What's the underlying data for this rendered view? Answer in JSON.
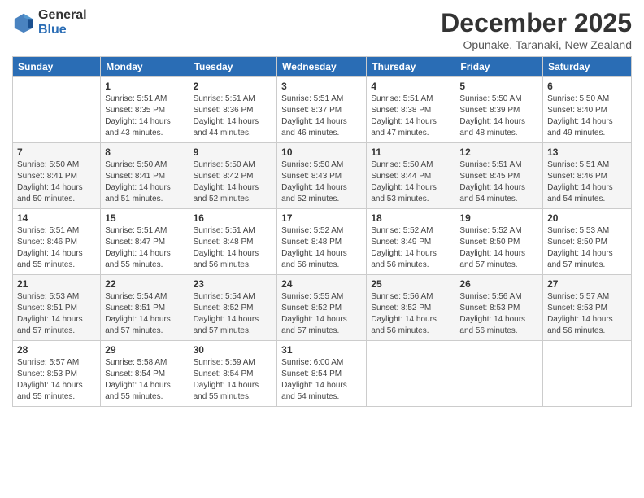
{
  "header": {
    "logo_general": "General",
    "logo_blue": "Blue",
    "month_title": "December 2025",
    "location": "Opunake, Taranaki, New Zealand"
  },
  "days_of_week": [
    "Sunday",
    "Monday",
    "Tuesday",
    "Wednesday",
    "Thursday",
    "Friday",
    "Saturday"
  ],
  "weeks": [
    [
      {
        "day": "",
        "sunrise": "",
        "sunset": "",
        "daylight": ""
      },
      {
        "day": "1",
        "sunrise": "Sunrise: 5:51 AM",
        "sunset": "Sunset: 8:35 PM",
        "daylight": "Daylight: 14 hours and 43 minutes."
      },
      {
        "day": "2",
        "sunrise": "Sunrise: 5:51 AM",
        "sunset": "Sunset: 8:36 PM",
        "daylight": "Daylight: 14 hours and 44 minutes."
      },
      {
        "day": "3",
        "sunrise": "Sunrise: 5:51 AM",
        "sunset": "Sunset: 8:37 PM",
        "daylight": "Daylight: 14 hours and 46 minutes."
      },
      {
        "day": "4",
        "sunrise": "Sunrise: 5:51 AM",
        "sunset": "Sunset: 8:38 PM",
        "daylight": "Daylight: 14 hours and 47 minutes."
      },
      {
        "day": "5",
        "sunrise": "Sunrise: 5:50 AM",
        "sunset": "Sunset: 8:39 PM",
        "daylight": "Daylight: 14 hours and 48 minutes."
      },
      {
        "day": "6",
        "sunrise": "Sunrise: 5:50 AM",
        "sunset": "Sunset: 8:40 PM",
        "daylight": "Daylight: 14 hours and 49 minutes."
      }
    ],
    [
      {
        "day": "7",
        "sunrise": "Sunrise: 5:50 AM",
        "sunset": "Sunset: 8:41 PM",
        "daylight": "Daylight: 14 hours and 50 minutes."
      },
      {
        "day": "8",
        "sunrise": "Sunrise: 5:50 AM",
        "sunset": "Sunset: 8:41 PM",
        "daylight": "Daylight: 14 hours and 51 minutes."
      },
      {
        "day": "9",
        "sunrise": "Sunrise: 5:50 AM",
        "sunset": "Sunset: 8:42 PM",
        "daylight": "Daylight: 14 hours and 52 minutes."
      },
      {
        "day": "10",
        "sunrise": "Sunrise: 5:50 AM",
        "sunset": "Sunset: 8:43 PM",
        "daylight": "Daylight: 14 hours and 52 minutes."
      },
      {
        "day": "11",
        "sunrise": "Sunrise: 5:50 AM",
        "sunset": "Sunset: 8:44 PM",
        "daylight": "Daylight: 14 hours and 53 minutes."
      },
      {
        "day": "12",
        "sunrise": "Sunrise: 5:51 AM",
        "sunset": "Sunset: 8:45 PM",
        "daylight": "Daylight: 14 hours and 54 minutes."
      },
      {
        "day": "13",
        "sunrise": "Sunrise: 5:51 AM",
        "sunset": "Sunset: 8:46 PM",
        "daylight": "Daylight: 14 hours and 54 minutes."
      }
    ],
    [
      {
        "day": "14",
        "sunrise": "Sunrise: 5:51 AM",
        "sunset": "Sunset: 8:46 PM",
        "daylight": "Daylight: 14 hours and 55 minutes."
      },
      {
        "day": "15",
        "sunrise": "Sunrise: 5:51 AM",
        "sunset": "Sunset: 8:47 PM",
        "daylight": "Daylight: 14 hours and 55 minutes."
      },
      {
        "day": "16",
        "sunrise": "Sunrise: 5:51 AM",
        "sunset": "Sunset: 8:48 PM",
        "daylight": "Daylight: 14 hours and 56 minutes."
      },
      {
        "day": "17",
        "sunrise": "Sunrise: 5:52 AM",
        "sunset": "Sunset: 8:48 PM",
        "daylight": "Daylight: 14 hours and 56 minutes."
      },
      {
        "day": "18",
        "sunrise": "Sunrise: 5:52 AM",
        "sunset": "Sunset: 8:49 PM",
        "daylight": "Daylight: 14 hours and 56 minutes."
      },
      {
        "day": "19",
        "sunrise": "Sunrise: 5:52 AM",
        "sunset": "Sunset: 8:50 PM",
        "daylight": "Daylight: 14 hours and 57 minutes."
      },
      {
        "day": "20",
        "sunrise": "Sunrise: 5:53 AM",
        "sunset": "Sunset: 8:50 PM",
        "daylight": "Daylight: 14 hours and 57 minutes."
      }
    ],
    [
      {
        "day": "21",
        "sunrise": "Sunrise: 5:53 AM",
        "sunset": "Sunset: 8:51 PM",
        "daylight": "Daylight: 14 hours and 57 minutes."
      },
      {
        "day": "22",
        "sunrise": "Sunrise: 5:54 AM",
        "sunset": "Sunset: 8:51 PM",
        "daylight": "Daylight: 14 hours and 57 minutes."
      },
      {
        "day": "23",
        "sunrise": "Sunrise: 5:54 AM",
        "sunset": "Sunset: 8:52 PM",
        "daylight": "Daylight: 14 hours and 57 minutes."
      },
      {
        "day": "24",
        "sunrise": "Sunrise: 5:55 AM",
        "sunset": "Sunset: 8:52 PM",
        "daylight": "Daylight: 14 hours and 57 minutes."
      },
      {
        "day": "25",
        "sunrise": "Sunrise: 5:56 AM",
        "sunset": "Sunset: 8:52 PM",
        "daylight": "Daylight: 14 hours and 56 minutes."
      },
      {
        "day": "26",
        "sunrise": "Sunrise: 5:56 AM",
        "sunset": "Sunset: 8:53 PM",
        "daylight": "Daylight: 14 hours and 56 minutes."
      },
      {
        "day": "27",
        "sunrise": "Sunrise: 5:57 AM",
        "sunset": "Sunset: 8:53 PM",
        "daylight": "Daylight: 14 hours and 56 minutes."
      }
    ],
    [
      {
        "day": "28",
        "sunrise": "Sunrise: 5:57 AM",
        "sunset": "Sunset: 8:53 PM",
        "daylight": "Daylight: 14 hours and 55 minutes."
      },
      {
        "day": "29",
        "sunrise": "Sunrise: 5:58 AM",
        "sunset": "Sunset: 8:54 PM",
        "daylight": "Daylight: 14 hours and 55 minutes."
      },
      {
        "day": "30",
        "sunrise": "Sunrise: 5:59 AM",
        "sunset": "Sunset: 8:54 PM",
        "daylight": "Daylight: 14 hours and 55 minutes."
      },
      {
        "day": "31",
        "sunrise": "Sunrise: 6:00 AM",
        "sunset": "Sunset: 8:54 PM",
        "daylight": "Daylight: 14 hours and 54 minutes."
      },
      {
        "day": "",
        "sunrise": "",
        "sunset": "",
        "daylight": ""
      },
      {
        "day": "",
        "sunrise": "",
        "sunset": "",
        "daylight": ""
      },
      {
        "day": "",
        "sunrise": "",
        "sunset": "",
        "daylight": ""
      }
    ]
  ]
}
